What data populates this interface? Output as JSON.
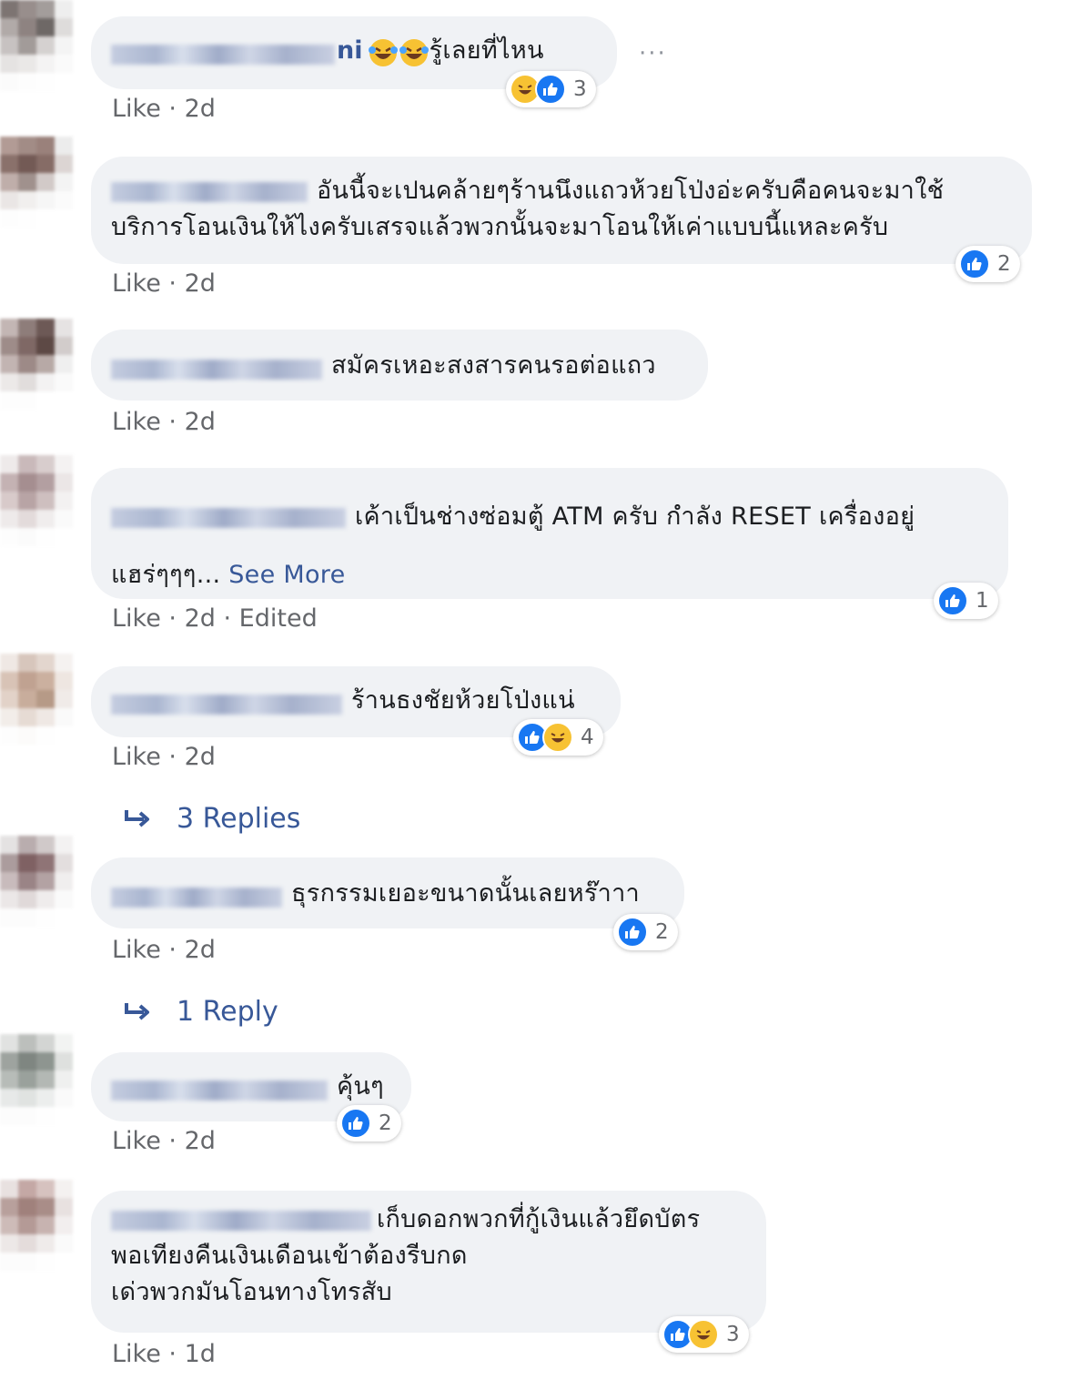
{
  "comments": [
    {
      "name_suffix": "ni",
      "text": "รู้เลยที่ไหน",
      "inline_emojis": [
        "rofl-emoji",
        "rofl-emoji"
      ],
      "reactions": [
        "haha",
        "like"
      ],
      "reaction_count": "3",
      "like": "Like",
      "time": "2d",
      "edited": ""
    },
    {
      "name_suffix": "",
      "text": "อันนี้จะเปนคล้ายๆร้านนึงแถวห้วยโป่งอ่ะครับคือคนจะมาใช้บริการโอนเงินให้ไงครับเสรจแล้วพวกนั้นจะมาโอนให้เค่าแบบนี้แหละครับ",
      "reactions": [
        "like"
      ],
      "reaction_count": "2",
      "like": "Like",
      "time": "2d",
      "edited": ""
    },
    {
      "name_suffix": "",
      "text": "สมัครเหอะสงสารคนรอต่อแถว",
      "reactions": [],
      "reaction_count": "",
      "like": "Like",
      "time": "2d",
      "edited": ""
    },
    {
      "name_suffix": "",
      "text_line1": "เค้าเป็นช่างซ่อมตู้ ATM ครับ กำลัง RESET เครื่องอยู่",
      "text_line2": "แฮร่ๆๆๆ...",
      "see_more": "See More",
      "reactions": [
        "like"
      ],
      "reaction_count": "1",
      "like": "Like",
      "time": "2d",
      "edited": "Edited"
    },
    {
      "name_suffix": "",
      "text": "ร้านธงชัยห้วยโป่งแน่",
      "reactions": [
        "like",
        "haha"
      ],
      "reaction_count": "4",
      "like": "Like",
      "time": "2d",
      "edited": "",
      "replies_label": "3 Replies"
    },
    {
      "name_suffix": "",
      "text": "ธุรกรรมเยอะขนาดนั้นเลยหร๊าาา",
      "reactions": [
        "like"
      ],
      "reaction_count": "2",
      "like": "Like",
      "time": "2d",
      "edited": "",
      "replies_label": "1 Reply"
    },
    {
      "name_suffix": "",
      "text": "คุ้นๆ",
      "reactions": [
        "like"
      ],
      "reaction_count": "2",
      "like": "Like",
      "time": "2d",
      "edited": ""
    },
    {
      "name_suffix": "",
      "text_line1": "เก็บดอกพวกที่กู้เงินแล้วยึดบัตร",
      "text_line2": "พอเทียงคืนเงินเดือนเข้าต้องรีบกด",
      "text_line3": "เด่วพวกมันโอนทางโทรสับ",
      "reactions": [
        "like",
        "haha"
      ],
      "reaction_count": "3",
      "like": "Like",
      "time": "1d",
      "edited": ""
    }
  ],
  "menu": {
    "more": "···"
  },
  "separator": " · ",
  "colors": {
    "bubble": "#f0f2f5",
    "link": "#385898",
    "meta": "#65676b",
    "like_blue": "#1877f2",
    "haha_yellow": "#f7c233"
  }
}
